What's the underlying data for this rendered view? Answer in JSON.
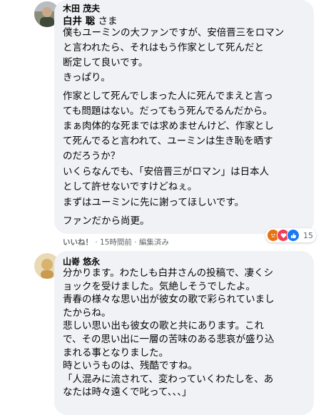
{
  "comment1": {
    "author": "木田 茂夫",
    "mention_name": "白井 聡",
    "mention_suffix": " さま",
    "paragraphs": [
      [
        "僕もユーミンの大ファンですが、安倍晋三をロマン",
        "と言われたら、それはもう作家として死んだと",
        "断定して良いです。"
      ],
      [
        "きっぱり。"
      ],
      [
        "作家として死んでしまった人に死んでまえと言っ",
        "ても問題はない。だってもう死んでるんだから。",
        "まぁ肉体的な死までは求めませんけど、作家とし",
        "て死んでると言われて、ユーミンは生き恥を晒す",
        "のだろうか？"
      ],
      [
        "いくらなんでも、「安倍晋三がロマン」は日本人",
        "として許せないですけどねぇ。"
      ],
      [
        "まずはユーミンに先に謝ってほしいです。"
      ],
      [
        "ファンだから尚更。"
      ]
    ],
    "actions": {
      "like": "いいね！",
      "sep": " · ",
      "time": "15時間前",
      "edited": "編集済み"
    },
    "reactions": {
      "icons": [
        "angry-reaction",
        "love-reaction",
        "like-reaction"
      ],
      "count": "15"
    }
  },
  "comment2": {
    "author": "山嵜 悠永",
    "lines": [
      "分かります。わたしも白井さんの投稿で、凄くシ",
      "ョックを受けました。気絶しそうでしたよ。",
      "青春の様々な思い出が彼女の歌で彩られていまし",
      "たからね。",
      "悲しい思い出も彼女の歌と共にあります。これ",
      "で、その思い出に一層の苦味のある悲哀が盛り込",
      "まれる事となりました。",
      "時というものは、残酷ですね。",
      "「人混みに流されて、変わっていくわたしを、あ",
      "なたは時々遠くで叱って、、、」"
    ]
  },
  "colors": {
    "bubble": "#f0f2f5",
    "secondary_text": "#65676b",
    "angry": "#e9710f",
    "love": "#f33e58",
    "like": "#1877f2"
  }
}
